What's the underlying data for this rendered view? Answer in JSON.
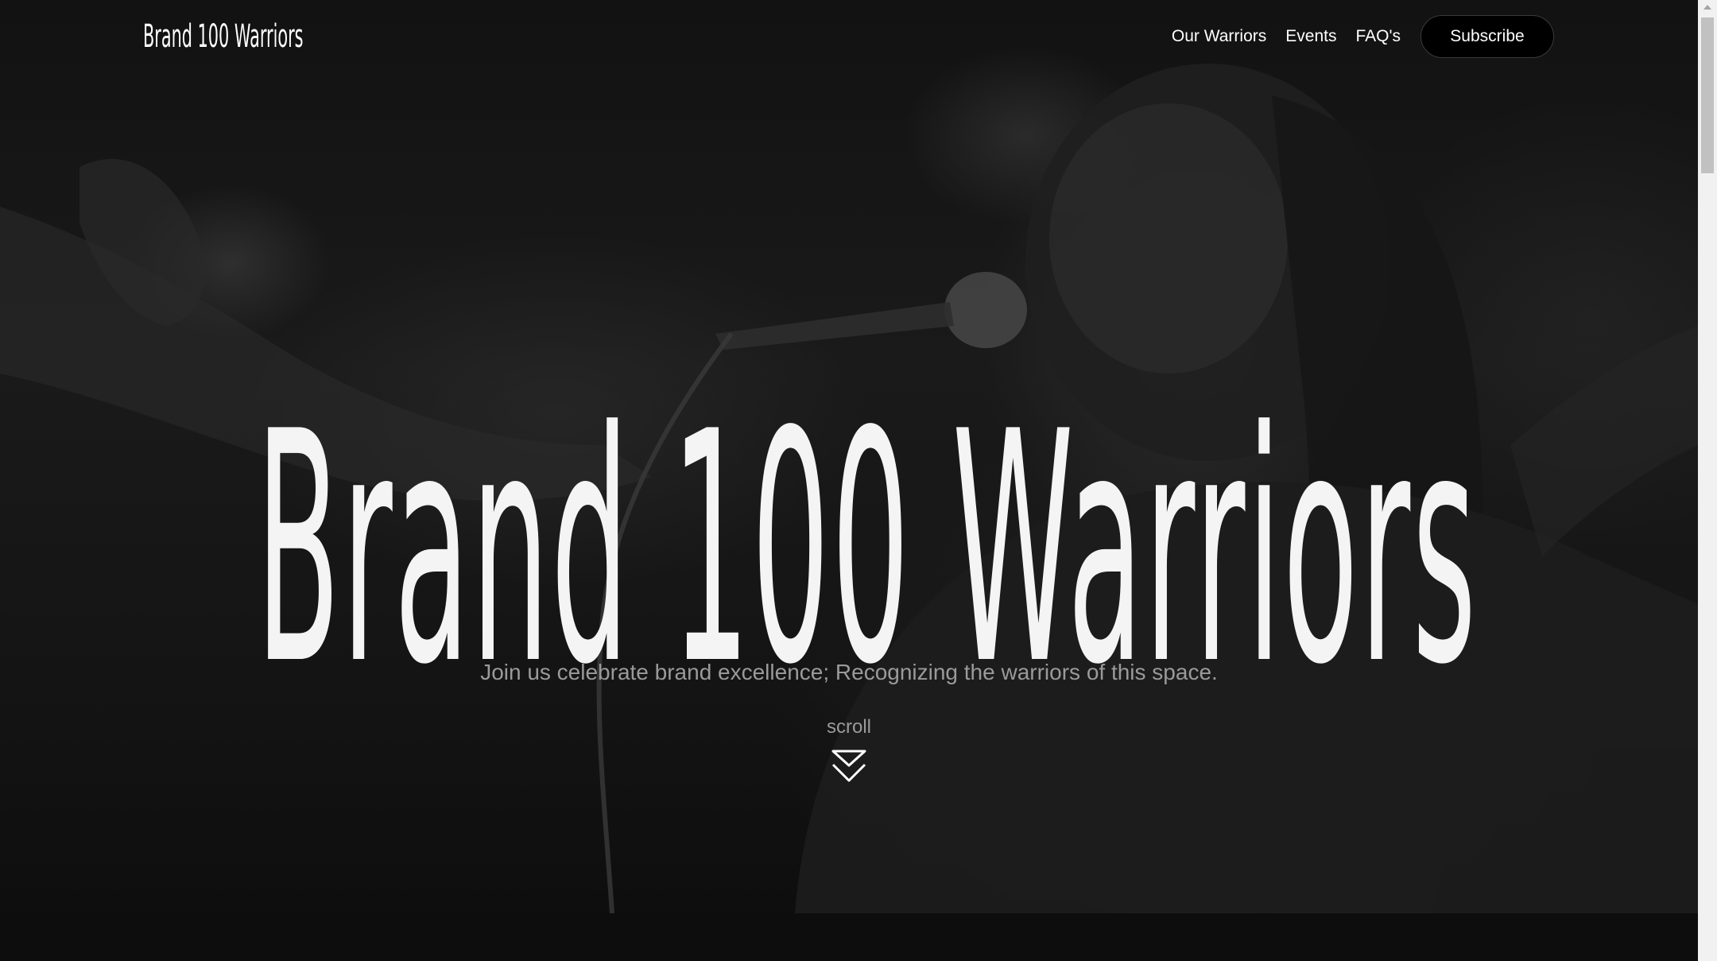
{
  "header": {
    "logo": "Brand 100 Warriors",
    "nav": [
      {
        "label": "Our Warriors"
      },
      {
        "label": "Events"
      },
      {
        "label": "FAQ's"
      }
    ],
    "subscribe_label": "Subscribe"
  },
  "hero": {
    "title": "Brand 100 Warriors",
    "subtitle": "Join us celebrate brand excellence; Recognizing the warriors of this space.",
    "scroll_label": "scroll",
    "scroll_icon": "chevron-double-down-icon",
    "background_image": "performer-singing-into-microphone"
  },
  "colors": {
    "background": "#0b0b0b",
    "text": "#ffffff",
    "muted_text": "#9a9a9a",
    "button_bg": "#000000"
  }
}
